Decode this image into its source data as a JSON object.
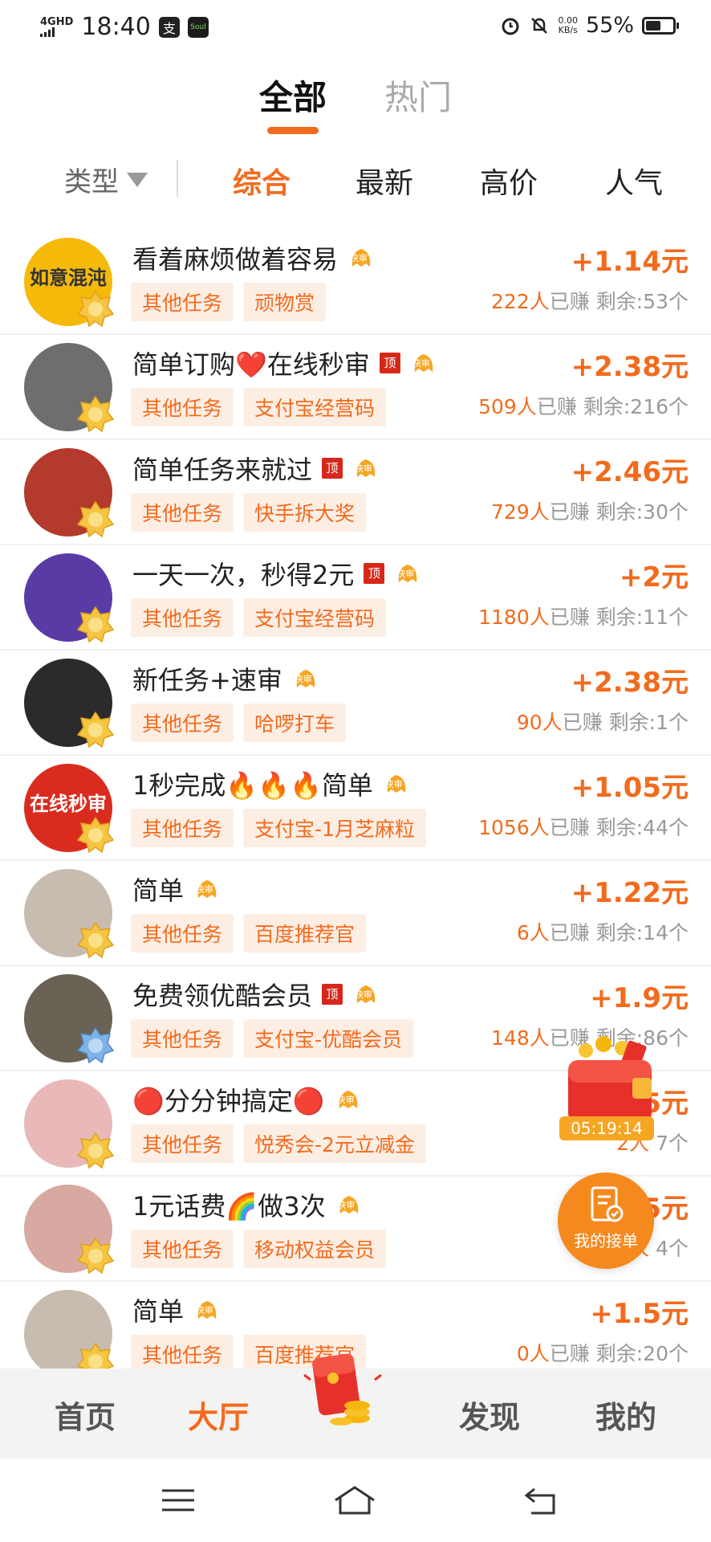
{
  "status_bar": {
    "network": "4GHD",
    "time": "18:40",
    "app1": "支",
    "app2": "Soul",
    "speed_value": "0.00",
    "speed_unit": "KB/s",
    "battery_pct": "55%",
    "battery_level": 0.55
  },
  "top_tabs": [
    {
      "label": "全部",
      "active": true
    },
    {
      "label": "热门",
      "active": false
    }
  ],
  "filter": {
    "type_label": "类型",
    "sorts": [
      "综合",
      "最新",
      "高价",
      "人气"
    ]
  },
  "tasks": [
    {
      "title": "看着麻烦做着容易",
      "top": false,
      "tags": [
        "其他任务",
        "顽物赏"
      ],
      "price": "+1.14元",
      "earned": "222人",
      "earned_suffix": "已赚",
      "remain": "剩余:53个",
      "avatar_text": "如意混沌",
      "avatar_bg": "#f5b90a"
    },
    {
      "title": "简单订购❤️在线秒审",
      "top": true,
      "tags": [
        "其他任务",
        "支付宝经营码"
      ],
      "price": "+2.38元",
      "earned": "509人",
      "earned_suffix": "已赚",
      "remain": "剩余:216个",
      "avatar_text": "",
      "avatar_bg": "#6e6e6e"
    },
    {
      "title": "简单任务来就过",
      "top": true,
      "tags": [
        "其他任务",
        "快手拆大奖"
      ],
      "price": "+2.46元",
      "earned": "729人",
      "earned_suffix": "已赚",
      "remain": "剩余:30个",
      "avatar_text": "",
      "avatar_bg": "#b33a2c"
    },
    {
      "title": "一天一次，秒得2元",
      "top": true,
      "tags": [
        "其他任务",
        "支付宝经营码"
      ],
      "price": "+2元",
      "earned": "1180人",
      "earned_suffix": "已赚",
      "remain": "剩余:11个",
      "avatar_text": "",
      "avatar_bg": "#5a3ba6"
    },
    {
      "title": "新任务+速审",
      "top": false,
      "tags": [
        "其他任务",
        "哈啰打车"
      ],
      "price": "+2.38元",
      "earned": "90人",
      "earned_suffix": "已赚",
      "remain": "剩余:1个",
      "avatar_text": "",
      "avatar_bg": "#2b2b2b"
    },
    {
      "title": "1秒完成🔥🔥🔥简单",
      "top": false,
      "tags": [
        "其他任务",
        "支付宝-1月芝麻粒"
      ],
      "price": "+1.05元",
      "earned": "1056人",
      "earned_suffix": "已赚",
      "remain": "剩余:44个",
      "avatar_text": "在线秒审",
      "avatar_bg": "#d92c1f"
    },
    {
      "title": "简单",
      "top": false,
      "tags": [
        "其他任务",
        "百度推荐官"
      ],
      "price": "+1.22元",
      "earned": "6人",
      "earned_suffix": "已赚",
      "remain": "剩余:14个",
      "avatar_text": "",
      "avatar_bg": "#c8bcb0"
    },
    {
      "title": "免费领优酷会员",
      "top": true,
      "tags": [
        "其他任务",
        "支付宝-优酷会员"
      ],
      "price": "+1.9元",
      "earned": "148人",
      "earned_suffix": "已赚",
      "remain": "剩余:86个",
      "avatar_text": "",
      "avatar_bg": "#6a6355"
    },
    {
      "title": "🔴分分钟搞定🔴",
      "top": false,
      "tags": [
        "其他任务",
        "悦秀会-2元立减金"
      ],
      "price": "5元",
      "earned": "2人",
      "earned_suffix": "",
      "remain": "7个",
      "avatar_text": "",
      "avatar_bg": "#e8b9b8"
    },
    {
      "title": "1元话费🌈做3次",
      "top": false,
      "tags": [
        "其他任务",
        "移动权益会员"
      ],
      "price": "65元",
      "earned": "6人",
      "earned_suffix": "",
      "remain": "4个",
      "avatar_text": "",
      "avatar_bg": "#d7a9a0"
    },
    {
      "title": "简单",
      "top": false,
      "tags": [
        "其他任务",
        "百度推荐官"
      ],
      "price": "+1.5元",
      "earned": "0人",
      "earned_suffix": "已赚",
      "remain": "剩余:20个",
      "avatar_text": "",
      "avatar_bg": "#c8bcb0"
    }
  ],
  "badges": {
    "top_label": "顶",
    "kuai_label": "快审"
  },
  "floating": {
    "timer": "05:19:14",
    "my_orders_label": "我的接单"
  },
  "tabbar": [
    "首页",
    "大厅",
    "发现",
    "我的"
  ],
  "colors": {
    "accent": "#f26b1d",
    "tag_bg": "#fdeee4",
    "top_badge": "#d6281a"
  }
}
